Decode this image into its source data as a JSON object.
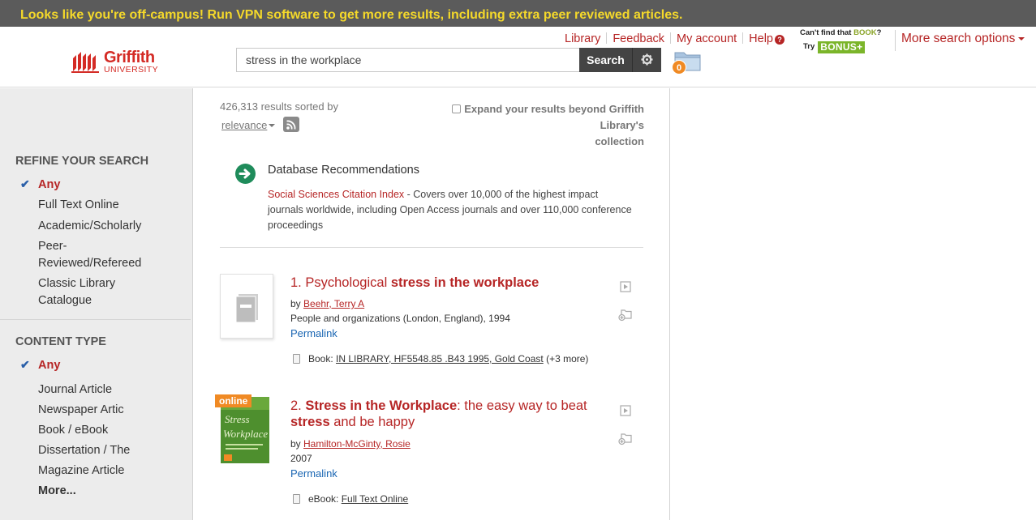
{
  "banner": {
    "text": "Looks like you're off-campus! Run VPN software to get more results, including extra peer reviewed articles."
  },
  "logo": {
    "word1": "Griffith",
    "word2": "UNIVERSITY"
  },
  "search": {
    "value": "stress in the workplace",
    "button_label": "Search"
  },
  "folder": {
    "count": "0"
  },
  "toplinks": {
    "library": "Library",
    "feedback": "Feedback",
    "my_account": "My account",
    "help": "Help"
  },
  "bonus": {
    "line1_a": "Can't find that ",
    "line1_b": "BOOK",
    "line1_c": "?",
    "try": "Try",
    "logo": "BONUS+"
  },
  "more_options": "More search options",
  "sidebar": {
    "refine_title": "REFINE YOUR SEARCH",
    "refine_items": [
      "Any",
      "Full Text Online",
      "Academic/Scholarly",
      "Peer-",
      "Reviewed/Refereed",
      "Classic Library",
      "Catalogue"
    ],
    "content_title": "CONTENT TYPE",
    "content_items": [
      "Any",
      "Journal Article",
      "Newspaper Artic",
      "Book / eBook",
      "Dissertation / The",
      "Magazine Article",
      "More..."
    ]
  },
  "results": {
    "count_text": "426,313 results sorted by",
    "sort_label": "relevance",
    "expand_line1": "Expand your results beyond Griffith Library's",
    "expand_line2": "collection",
    "db_rec": {
      "title": "Database Recommendations",
      "link": "Social Sciences Citation Index",
      "desc": " - Covers over 10,000 of the highest impact journals worldwide, including Open Access journals and over 110,000 conference proceedings"
    },
    "items": [
      {
        "num": "1.",
        "title_plain": "Psychological ",
        "title_bold": "stress in the workplace",
        "title_rest": "",
        "by": "by ",
        "author": "Beehr, Terry A",
        "source": "People and organizations (London, England), 1994",
        "permalink": "Permalink",
        "holding_label": "Book: ",
        "holding_link": "IN LIBRARY, HF5548.85 .B43 1995, Gold Coast",
        "holding_more": " (+3 more)"
      },
      {
        "num": "2.",
        "badge": "online",
        "title_bold": "Stress in the Workplace",
        "title_rest": ": the easy way to beat",
        "title_bold2": "stress",
        "title_rest2": " and be happy",
        "by": "by ",
        "author": "Hamilton-McGinty, Rosie",
        "source": "2007",
        "permalink": "Permalink",
        "holding_label": "eBook: ",
        "holding_link": "Full Text Online",
        "cover_text1": "Stress",
        "cover_text2": "Workplace"
      }
    ]
  },
  "colors": {
    "accent": "#b62525",
    "banner_bg": "#5b5b5b",
    "banner_text": "#f5d92a",
    "link_blue": "#1a66b3",
    "badge": "#f08a24"
  }
}
